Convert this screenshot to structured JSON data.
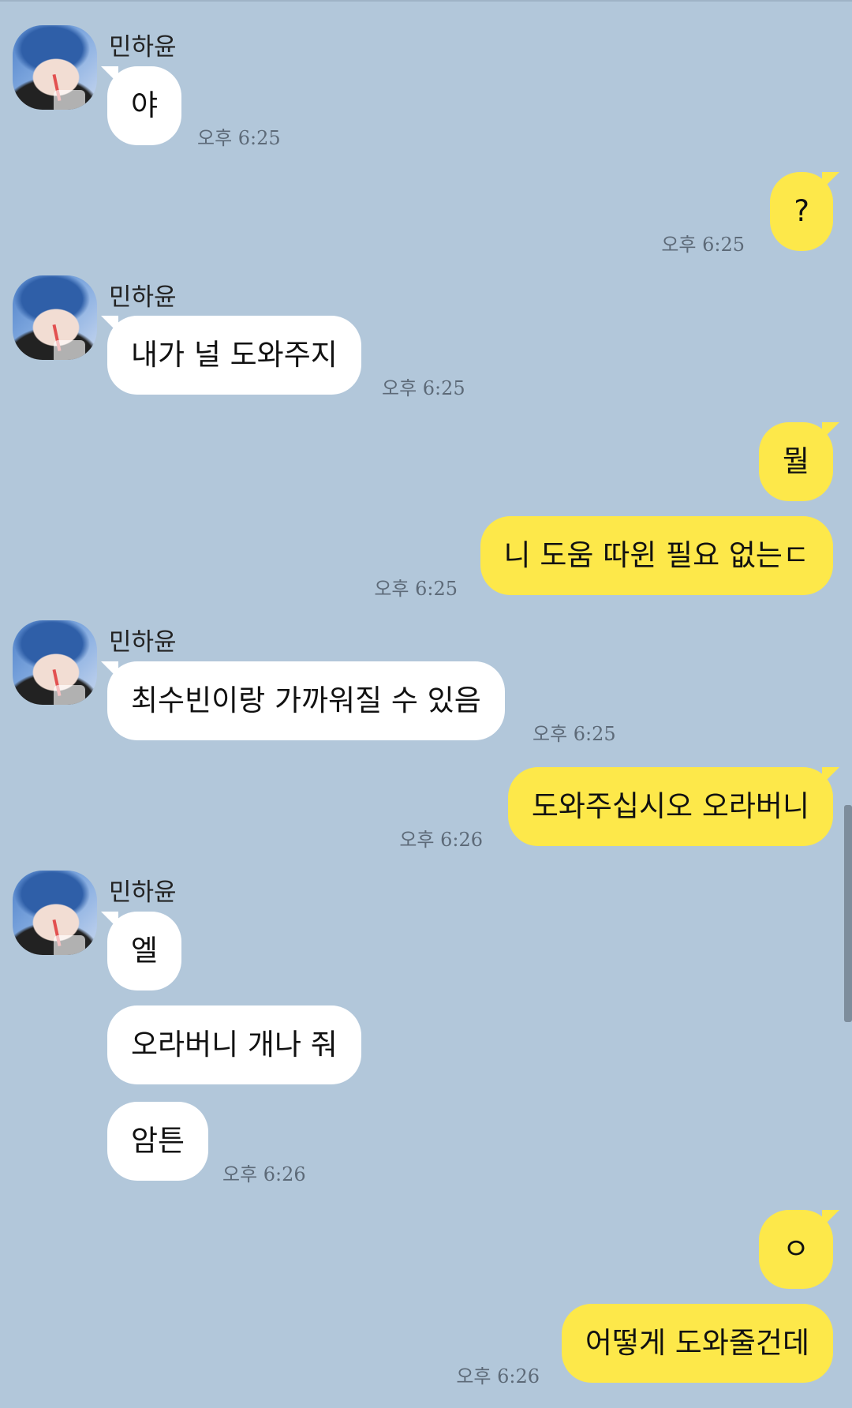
{
  "chat": {
    "sender_name": "민하윤",
    "messages": [
      {
        "text": "야",
        "time": "오후 6:25"
      },
      {
        "text": "?",
        "time": "오후 6:25"
      },
      {
        "text": "내가 널 도와주지",
        "time": "오후 6:25"
      },
      {
        "text": "뭘"
      },
      {
        "text": "니 도움 따윈 필요 없는ㄷ",
        "time": "오후 6:25"
      },
      {
        "text": "최수빈이랑 가까워질 수 있음",
        "time": "오후 6:25"
      },
      {
        "text": "도와주십시오 오라버니",
        "time": "오후 6:26"
      },
      {
        "text": "엘"
      },
      {
        "text": "오라버니 개나 줘"
      },
      {
        "text": "암튼",
        "time": "오후 6:26"
      },
      {
        "text": "ㅇ"
      },
      {
        "text": "어떻게 도와줄건데",
        "time": "오후 6:26"
      }
    ]
  },
  "colors": {
    "background": "#b2c7da",
    "incoming_bubble": "#ffffff",
    "outgoing_bubble": "#fde84a",
    "timestamp": "#5d6a78"
  },
  "icons": {
    "avatar": "profile-photo"
  }
}
